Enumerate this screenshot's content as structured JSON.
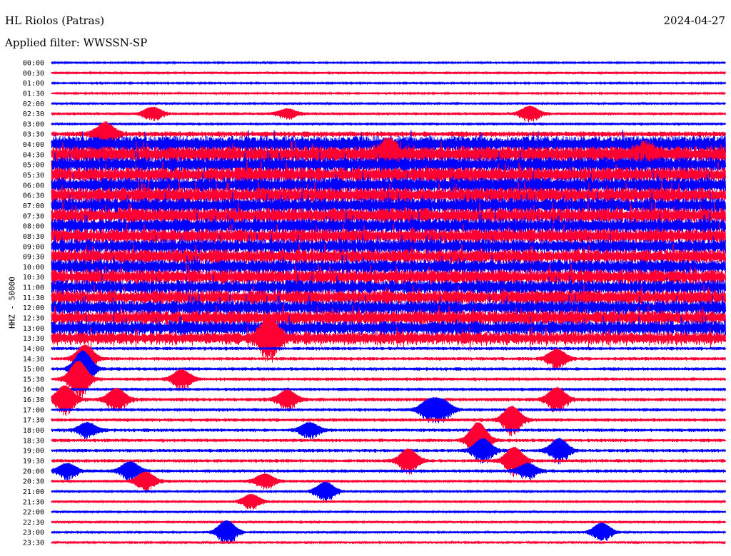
{
  "header": {
    "station": "HL Riolos (Patras)",
    "date": "2024-04-27",
    "filter": "Applied filter: WWSSN-SP"
  },
  "chart_data": {
    "type": "line",
    "title": "HL Riolos (Patras)",
    "ylabel": "HHZ - 50000",
    "minutes_per_line": 30,
    "colors": [
      "#0000ff",
      "#ff0033"
    ],
    "rows": [
      "00:00",
      "00:30",
      "01:00",
      "01:30",
      "02:00",
      "02:30",
      "03:00",
      "03:30",
      "04:00",
      "04:30",
      "05:00",
      "05:30",
      "06:00",
      "06:30",
      "07:00",
      "07:30",
      "08:00",
      "08:30",
      "09:00",
      "09:30",
      "10:00",
      "10:30",
      "11:00",
      "11:30",
      "12:00",
      "12:30",
      "13:00",
      "13:30",
      "14:00",
      "14:30",
      "15:00",
      "15:30",
      "16:00",
      "16:30",
      "17:00",
      "17:30",
      "18:00",
      "18:30",
      "19:00",
      "19:30",
      "20:00",
      "20:30",
      "21:00",
      "21:30",
      "22:00",
      "22:30",
      "23:00",
      "23:30"
    ],
    "noise_level": [
      0.08,
      0.12,
      0.08,
      0.08,
      0.12,
      0.15,
      0.15,
      0.3,
      0.9,
      0.9,
      0.85,
      0.85,
      0.85,
      0.85,
      0.85,
      0.85,
      0.85,
      0.8,
      0.8,
      0.8,
      0.8,
      0.8,
      0.8,
      0.8,
      0.8,
      0.8,
      0.8,
      0.7,
      0.18,
      0.18,
      0.18,
      0.18,
      0.18,
      0.2,
      0.18,
      0.18,
      0.18,
      0.18,
      0.18,
      0.18,
      0.18,
      0.15,
      0.15,
      0.12,
      0.12,
      0.12,
      0.12,
      0.12
    ],
    "events": [
      {
        "row": 5,
        "minute": 4.5,
        "amp": 0.7
      },
      {
        "row": 5,
        "minute": 10.5,
        "amp": 0.5
      },
      {
        "row": 5,
        "minute": 21.3,
        "amp": 0.8
      },
      {
        "row": 7,
        "minute": 2.4,
        "amp": 1.2
      },
      {
        "row": 9,
        "minute": 15,
        "amp": 1.2
      },
      {
        "row": 9,
        "minute": 26.5,
        "amp": 0.8
      },
      {
        "row": 27,
        "minute": 9.7,
        "amp": 2.2
      },
      {
        "row": 29,
        "minute": 1.5,
        "amp": 1.5
      },
      {
        "row": 29,
        "minute": 22.5,
        "amp": 1.0
      },
      {
        "row": 30,
        "minute": 1.4,
        "amp": 2.0
      },
      {
        "row": 31,
        "minute": 1.2,
        "amp": 2.0
      },
      {
        "row": 31,
        "minute": 5.8,
        "amp": 1.0
      },
      {
        "row": 33,
        "minute": 0.6,
        "amp": 1.5
      },
      {
        "row": 33,
        "minute": 2.9,
        "amp": 1.2
      },
      {
        "row": 33,
        "minute": 10.5,
        "amp": 1.0
      },
      {
        "row": 33,
        "minute": 22.5,
        "amp": 1.3
      },
      {
        "row": 34,
        "minute": 16.8,
        "amp": 1.0
      },
      {
        "row": 34,
        "minute": 17.4,
        "amp": 1.0
      },
      {
        "row": 35,
        "minute": 20.5,
        "amp": 1.5
      },
      {
        "row": 36,
        "minute": 1.6,
        "amp": 0.8
      },
      {
        "row": 36,
        "minute": 11.5,
        "amp": 0.8
      },
      {
        "row": 37,
        "minute": 19.0,
        "amp": 2.0
      },
      {
        "row": 38,
        "minute": 19.2,
        "amp": 1.3
      },
      {
        "row": 38,
        "minute": 22.6,
        "amp": 1.3
      },
      {
        "row": 39,
        "minute": 15.9,
        "amp": 1.3
      },
      {
        "row": 39,
        "minute": 20.6,
        "amp": 1.5
      },
      {
        "row": 40,
        "minute": 0.7,
        "amp": 0.8
      },
      {
        "row": 40,
        "minute": 3.5,
        "amp": 1.0
      },
      {
        "row": 40,
        "minute": 21.2,
        "amp": 0.8
      },
      {
        "row": 41,
        "minute": 4.2,
        "amp": 1.0
      },
      {
        "row": 41,
        "minute": 9.5,
        "amp": 0.8
      },
      {
        "row": 42,
        "minute": 12.2,
        "amp": 1.0
      },
      {
        "row": 43,
        "minute": 8.9,
        "amp": 0.8
      },
      {
        "row": 46,
        "minute": 7.8,
        "amp": 1.3
      },
      {
        "row": 46,
        "minute": 24.5,
        "amp": 1.0
      }
    ]
  }
}
